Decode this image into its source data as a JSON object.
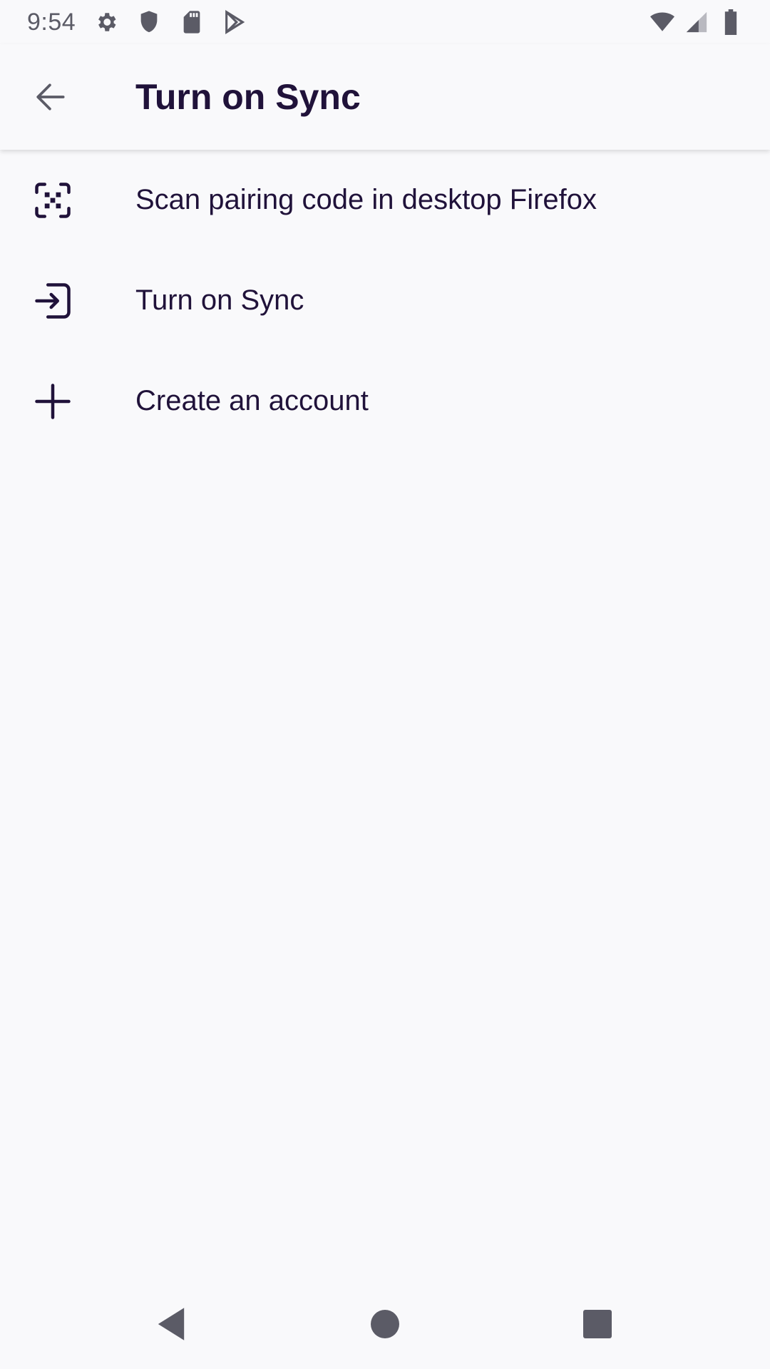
{
  "status_bar": {
    "time": "9:54",
    "icons": [
      "settings-icon",
      "shield-icon",
      "sd-card-icon",
      "play-store-icon"
    ],
    "right_icons": [
      "wifi-icon",
      "signal-icon",
      "battery-icon"
    ]
  },
  "toolbar": {
    "back_icon": "arrow-back-icon",
    "title": "Turn on Sync"
  },
  "menu": {
    "items": [
      {
        "icon": "qr-scan-icon",
        "label": "Scan pairing code in desktop Firefox"
      },
      {
        "icon": "sign-in-icon",
        "label": "Turn on Sync"
      },
      {
        "icon": "plus-icon",
        "label": "Create an account"
      }
    ]
  },
  "nav_bar": {
    "buttons": [
      "back-triangle-icon",
      "home-circle-icon",
      "recents-square-icon"
    ]
  },
  "colors": {
    "background": "#f9f9fb",
    "text_primary": "#20123a",
    "status_grey": "#5b5b66"
  }
}
